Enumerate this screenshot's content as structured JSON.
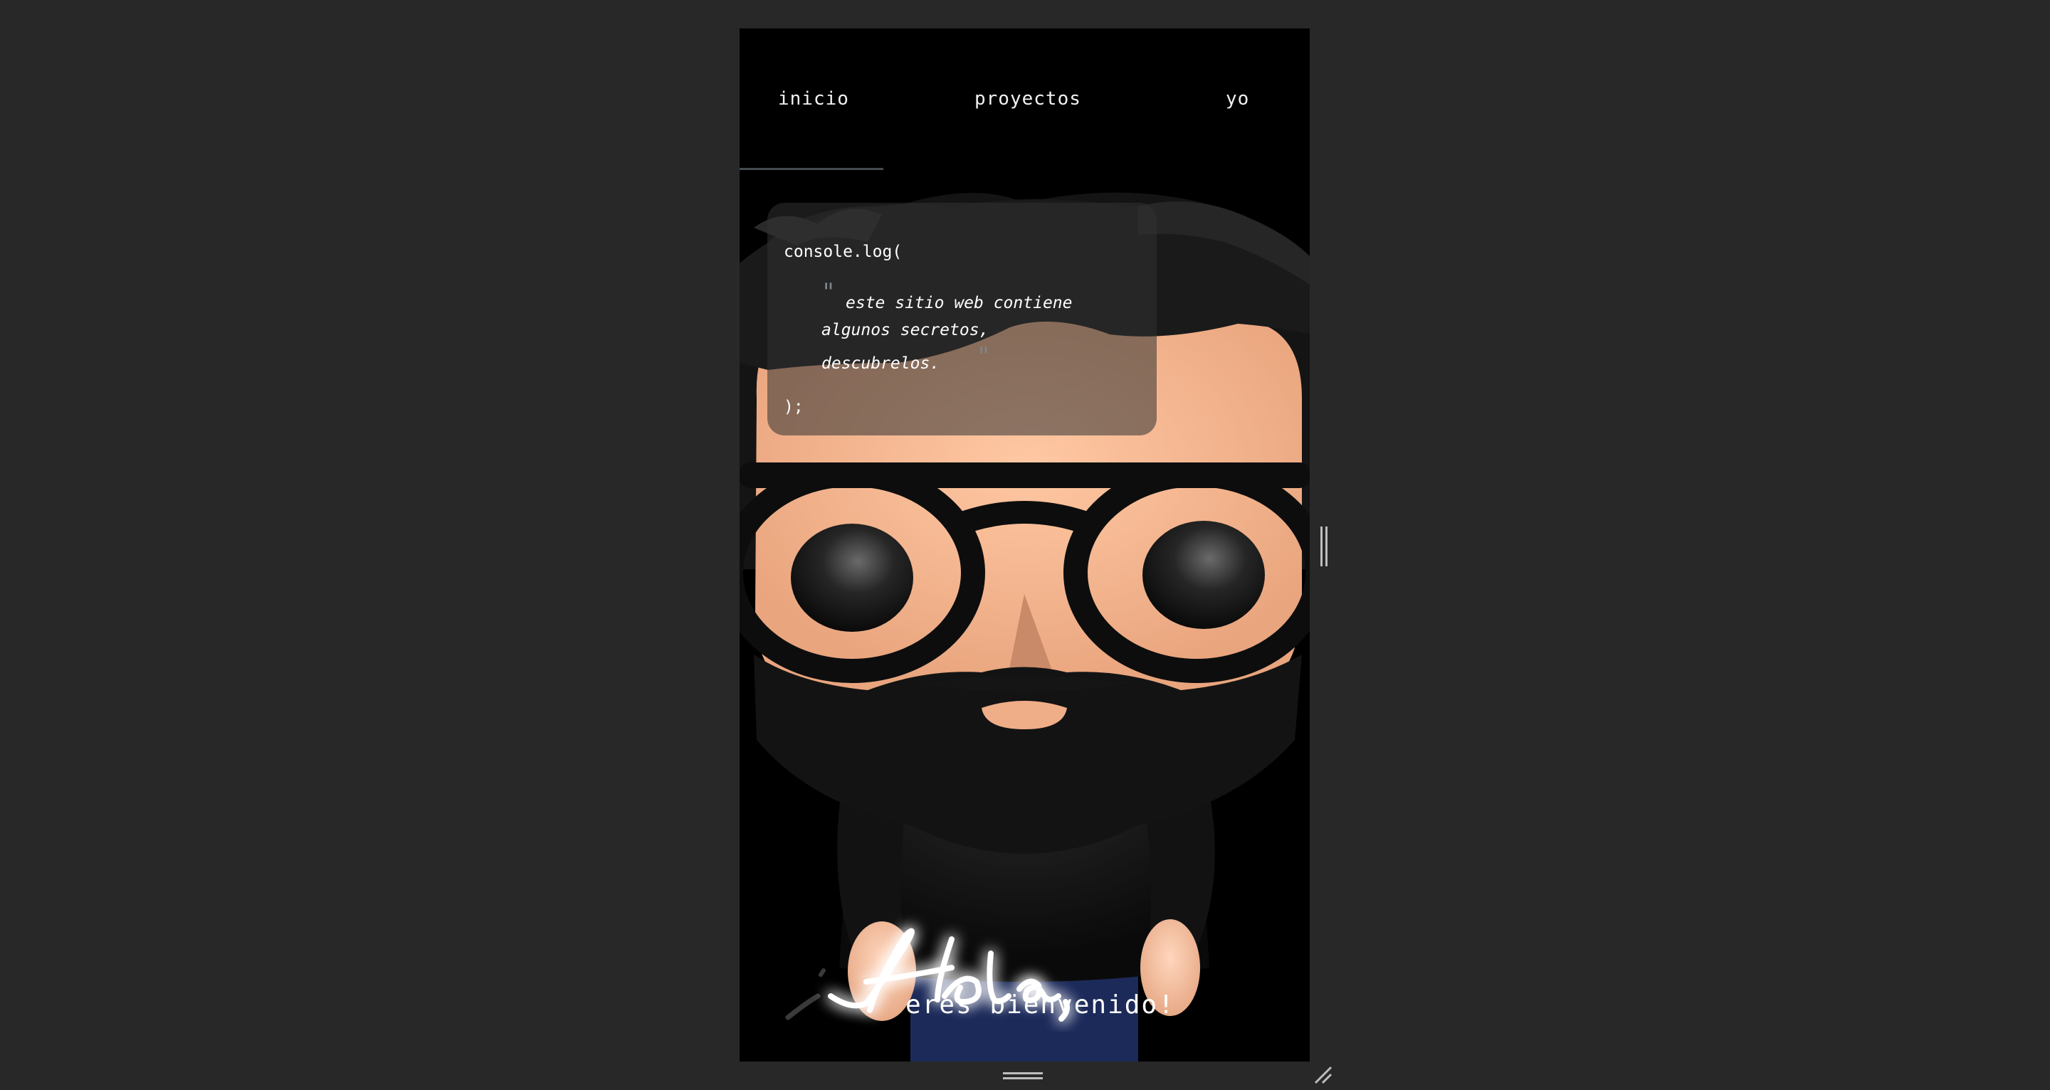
{
  "nav": {
    "items": [
      {
        "label": "inicio"
      },
      {
        "label": "proyectos"
      },
      {
        "label": "yo"
      }
    ],
    "active_index": 0
  },
  "code_card": {
    "open": "console.log(",
    "lines": [
      "este sitio web contiene",
      "algunos secretos,",
      "descubrelos."
    ],
    "close": ");"
  },
  "hero": {
    "script_text": "¡Hola,",
    "subtitle": "eres bienvenido!"
  },
  "colors": {
    "page_bg": "#282828",
    "frame_bg": "#000000",
    "accent_quote": "#7e878c",
    "skin": "#f5b48f",
    "glow": "#7fd8ff"
  },
  "icons": {
    "bottom_handle": "drag-handle-icon",
    "side_handle": "side-resize-handle-icon",
    "corner": "resize-corner-icon"
  }
}
